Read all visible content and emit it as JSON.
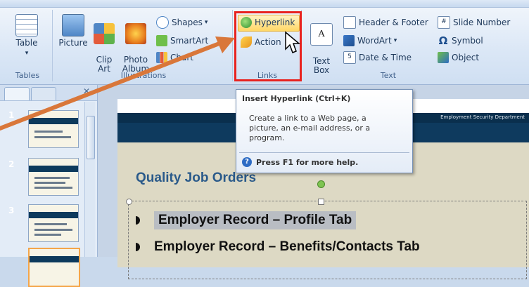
{
  "ribbon": {
    "groups": {
      "tables": {
        "label": "Tables",
        "table": "Table"
      },
      "illustrations": {
        "label": "Illustrations",
        "picture": "Picture",
        "clip_art": "Clip\nArt",
        "photo_album": "Photo\nAlbum",
        "shapes": "Shapes",
        "smartart": "SmartArt",
        "chart": "Chart"
      },
      "links": {
        "label": "Links",
        "hyperlink": "Hyperlink",
        "action": "Action"
      },
      "text": {
        "label": "Text",
        "text_box": "Text\nBox",
        "header_footer": "Header & Footer",
        "wordart": "WordArt",
        "date_time": "Date & Time",
        "slide_number": "Slide Number",
        "symbol": "Symbol",
        "object": "Object"
      }
    }
  },
  "tooltip": {
    "title": "Insert Hyperlink (Ctrl+K)",
    "body": "Create a link to a Web page, a picture, an e-mail address, or a program.",
    "help": "Press F1 for more help."
  },
  "slides_panel": {
    "numbers": [
      "1",
      "2",
      "3"
    ]
  },
  "slide": {
    "department": "Employment Security Department",
    "title": "Quality Job Orders",
    "bullets": [
      "Employer Record – Profile Tab",
      "Employer Record – Benefits/Contacts Tab"
    ]
  },
  "colors": {
    "highlight_border": "#e8231f",
    "arrow": "#d9773a",
    "band": "#0e3a5e"
  }
}
